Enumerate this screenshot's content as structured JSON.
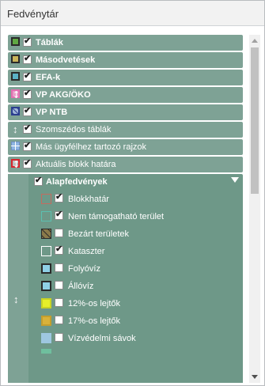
{
  "panel": {
    "title": "Fedvénytár"
  },
  "layers": [
    {
      "label": "Táblák",
      "icon": "solid-square-icon",
      "swatch_fill": "#5fa843",
      "swatch_border": "#2a2a2a",
      "checked": true,
      "bold": true
    },
    {
      "label": "Másodvetések",
      "icon": "solid-square-icon",
      "swatch_fill": "#c9b45a",
      "swatch_border": "#2a2a2a",
      "checked": true,
      "bold": true
    },
    {
      "label": "EFA-k",
      "icon": "solid-square-icon",
      "swatch_fill": "#5bb1c6",
      "swatch_border": "#2a2a2a",
      "checked": true,
      "bold": true
    },
    {
      "label": "VP AKG/ÖKO",
      "icon": "pink-vertical-arrows-icon",
      "swatch_fill": "#e99bc8",
      "swatch_border": "#e36eb0",
      "checked": true,
      "bold": true
    },
    {
      "label": "VP NTB",
      "icon": "hatched-square-icon",
      "swatch_fill": "#9fb4d8",
      "swatch_border": "#2c3e8f",
      "checked": true,
      "bold": true
    },
    {
      "label": "Szomszédos táblák",
      "icon": "vertical-arrows-icon",
      "swatch_fill": "",
      "swatch_border": "",
      "checked": true,
      "bold": false
    },
    {
      "label": "Más ügyfélhez tartozó rajzok",
      "icon": "grid-square-icon",
      "swatch_fill": "#8fb6e3",
      "swatch_border": "#6f8fc4",
      "checked": true,
      "bold": false
    },
    {
      "label": "Aktuális blokk határa",
      "icon": "red-vertical-arrows-icon",
      "swatch_fill": "#bfbfbf",
      "swatch_border": "#d7262e",
      "checked": true,
      "bold": false
    }
  ],
  "group": {
    "label": "Alapfedvények",
    "checked": true,
    "expand_icon": "triangle-down-icon",
    "gutter_icon": "vertical-arrows-icon",
    "items": [
      {
        "label": "Blokkhatár",
        "icon": "outline-square-icon",
        "swatch_fill": "transparent",
        "swatch_border": "#c46b5f",
        "checked": true
      },
      {
        "label": "Nem támogatható terület",
        "icon": "outline-square-icon",
        "swatch_fill": "transparent",
        "swatch_border": "#5bc0b0",
        "checked": true
      },
      {
        "label": "Bezárt területek",
        "icon": "hatched-square-icon",
        "swatch_fill": "#8b7a4a",
        "swatch_border": "#2a2a2a",
        "checked": false
      },
      {
        "label": "Kataszter",
        "icon": "outline-square-icon",
        "swatch_fill": "transparent",
        "swatch_border": "#ffffff",
        "checked": true
      },
      {
        "label": "Folyóvíz",
        "icon": "solid-square-icon",
        "swatch_fill": "#8fd0e6",
        "swatch_border": "#2a2a2a",
        "checked": false
      },
      {
        "label": "Állóvíz",
        "icon": "solid-square-icon",
        "swatch_fill": "#8fd0e6",
        "swatch_border": "#2a2a2a",
        "checked": false
      },
      {
        "label": "12%-os lejtők",
        "icon": "solid-square-icon",
        "swatch_fill": "#e6ef2a",
        "swatch_border": "#e6ef2a",
        "checked": false
      },
      {
        "label": "17%-os lejtők",
        "icon": "solid-square-icon",
        "swatch_fill": "#d9b23a",
        "swatch_border": "#d9b23a",
        "checked": false
      },
      {
        "label": "Vízvédelmi sávok",
        "icon": "dotted-square-icon",
        "swatch_fill": "#9ec7e0",
        "swatch_border": "#9ec7e0",
        "checked": false
      }
    ]
  },
  "scrollbar": {
    "up_icon": "scroll-up-arrow-icon",
    "down_icon": "scroll-down-arrow-icon"
  }
}
